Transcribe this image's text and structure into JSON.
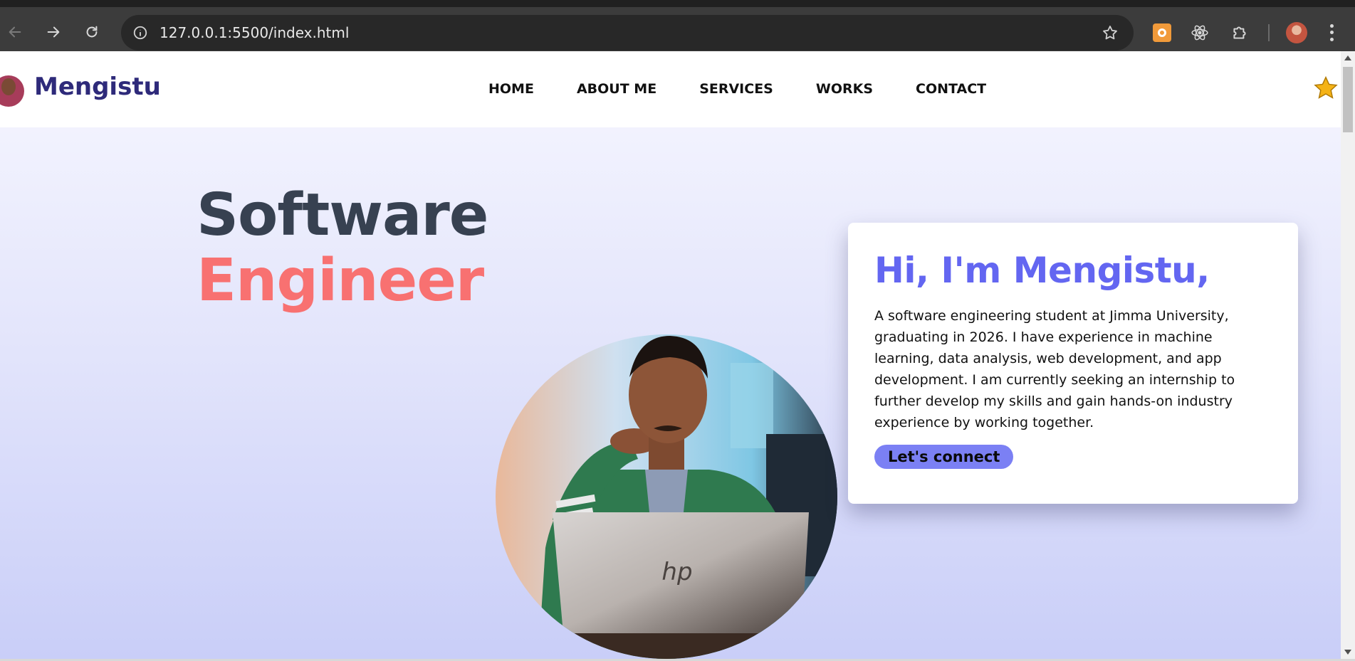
{
  "browser": {
    "url": "127.0.0.1:5500/index.html",
    "icons": {
      "back": "back-arrow-icon",
      "forward": "forward-arrow-icon",
      "reload": "reload-icon",
      "site_info": "info-icon",
      "bookmark": "star-icon",
      "extensions": [
        "orange-extension-icon",
        "react-icon",
        "puzzle-icon"
      ],
      "menu": "three-dots-icon"
    }
  },
  "header": {
    "logo_text": "Mengistu",
    "nav": [
      "HOME",
      "ABOUT ME",
      "SERVICES",
      "WORKS",
      "CONTACT"
    ],
    "theme_icon": "star-icon"
  },
  "hero": {
    "title_line1": "Software",
    "title_line2": "Engineer"
  },
  "intro": {
    "heading": "Hi, I'm Mengistu,",
    "description": "A software engineering student at Jimma University, graduating in 2026. I have experience in machine learning, data analysis, web development, and app development. I am currently seeking an internship to further develop my skills and gain hands-on industry experience by working together.",
    "cta_label": "Let's connect"
  },
  "colors": {
    "logo": "#2e2a7a",
    "title_dark": "#374151",
    "title_accent": "#f87171",
    "heading": "#6366f1",
    "button": "#7b80f4"
  }
}
